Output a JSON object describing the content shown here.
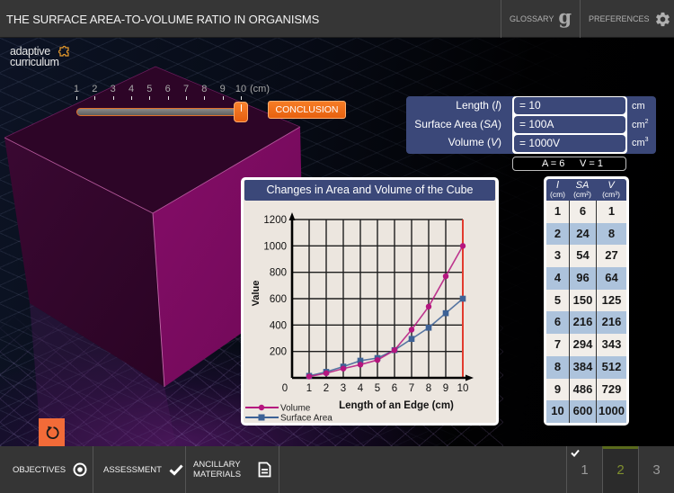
{
  "header": {
    "title": "THE SURFACE AREA-TO-VOLUME RATIO IN ORGANISMS",
    "glossary_label": "GLOSSARY",
    "glossary_icon_glyph": "g",
    "preferences_label": "PREFERENCES"
  },
  "logo": {
    "line1": "adaptive",
    "line2": "curriculum"
  },
  "slider": {
    "ticks": [
      "1",
      "2",
      "3",
      "4",
      "5",
      "6",
      "7",
      "8",
      "9",
      "10"
    ],
    "unit_label": "(cm)",
    "min": 1,
    "max": 10,
    "value": 10
  },
  "conclusion_button": {
    "label": "CONCLUSION"
  },
  "measurements": [
    {
      "label_before": "Length (",
      "var": "l",
      "label_after": ")",
      "value": "= 10",
      "unit": "cm",
      "unit_sup": ""
    },
    {
      "label_before": "Surface Area (",
      "var": "SA",
      "label_after": ")",
      "value": "= 100A",
      "unit": "cm",
      "unit_sup": "2"
    },
    {
      "label_before": "Volume (",
      "var": "V",
      "label_after": ")",
      "value": "= 1000V",
      "unit": "cm",
      "unit_sup": "3"
    }
  ],
  "unit_key": {
    "area": "A = 6",
    "volume": "V = 1"
  },
  "table": {
    "headers": [
      {
        "var": "l",
        "unit": "(cm)"
      },
      {
        "var": "SA",
        "unit": "(cm²)"
      },
      {
        "var": "V",
        "unit": "(cm³)"
      }
    ],
    "rows": [
      [
        "1",
        "6",
        "1"
      ],
      [
        "2",
        "24",
        "8"
      ],
      [
        "3",
        "54",
        "27"
      ],
      [
        "4",
        "96",
        "64"
      ],
      [
        "5",
        "150",
        "125"
      ],
      [
        "6",
        "216",
        "216"
      ],
      [
        "7",
        "294",
        "343"
      ],
      [
        "8",
        "384",
        "512"
      ],
      [
        "9",
        "486",
        "729"
      ],
      [
        "10",
        "600",
        "1000"
      ]
    ]
  },
  "chart_data": {
    "type": "line",
    "title": "Changes in Area and Volume of the Cube",
    "xlabel": "Length of an Edge (cm)",
    "ylabel": "Value",
    "x": [
      1,
      2,
      3,
      4,
      5,
      6,
      7,
      8,
      9,
      10
    ],
    "x_ticks": [
      "0",
      "1",
      "2",
      "3",
      "4",
      "5",
      "6",
      "7",
      "8",
      "9",
      "10"
    ],
    "y_ticks": [
      "200",
      "400",
      "600",
      "800",
      "1000",
      "1200"
    ],
    "xlim": [
      0,
      10
    ],
    "ylim": [
      0,
      1200
    ],
    "grid": true,
    "legend": "bottom-left",
    "highlight_x": 10,
    "series": [
      {
        "name": "Volume",
        "color": "#b5157f",
        "marker": "circle",
        "values": [
          10,
          35,
          70,
          100,
          135,
          210,
          365,
          540,
          770,
          1000
        ]
      },
      {
        "name": "Surface Area",
        "color": "#3d6296",
        "marker": "square",
        "values": [
          15,
          45,
          85,
          130,
          150,
          210,
          295,
          380,
          490,
          600
        ]
      }
    ]
  },
  "footer": {
    "objectives_label": "OBJECTIVES",
    "assessment_label": "ASSESSMENT",
    "ancillary_label": "ANCILLARY MATERIALS",
    "pages": [
      {
        "label": "1",
        "completed": true,
        "active": false
      },
      {
        "label": "2",
        "completed": false,
        "active": true
      },
      {
        "label": "3",
        "completed": false,
        "active": false
      }
    ]
  },
  "colors": {
    "accent_orange": "#f26a1b",
    "panel_blue": "#3b4879",
    "page_active_green": "#7f8f2e",
    "marker_line_red": "#e23b2e",
    "cube_magenta": "#7c0a60"
  },
  "icons": {
    "glossary": "glossary-g-icon",
    "preferences": "gear-icon",
    "undo": "undo-icon",
    "objectives": "target-icon",
    "assessment": "checkmark-icon",
    "ancillary": "document-icon",
    "page_completed": "checkmark-icon",
    "logo": "puzzle-icon"
  }
}
